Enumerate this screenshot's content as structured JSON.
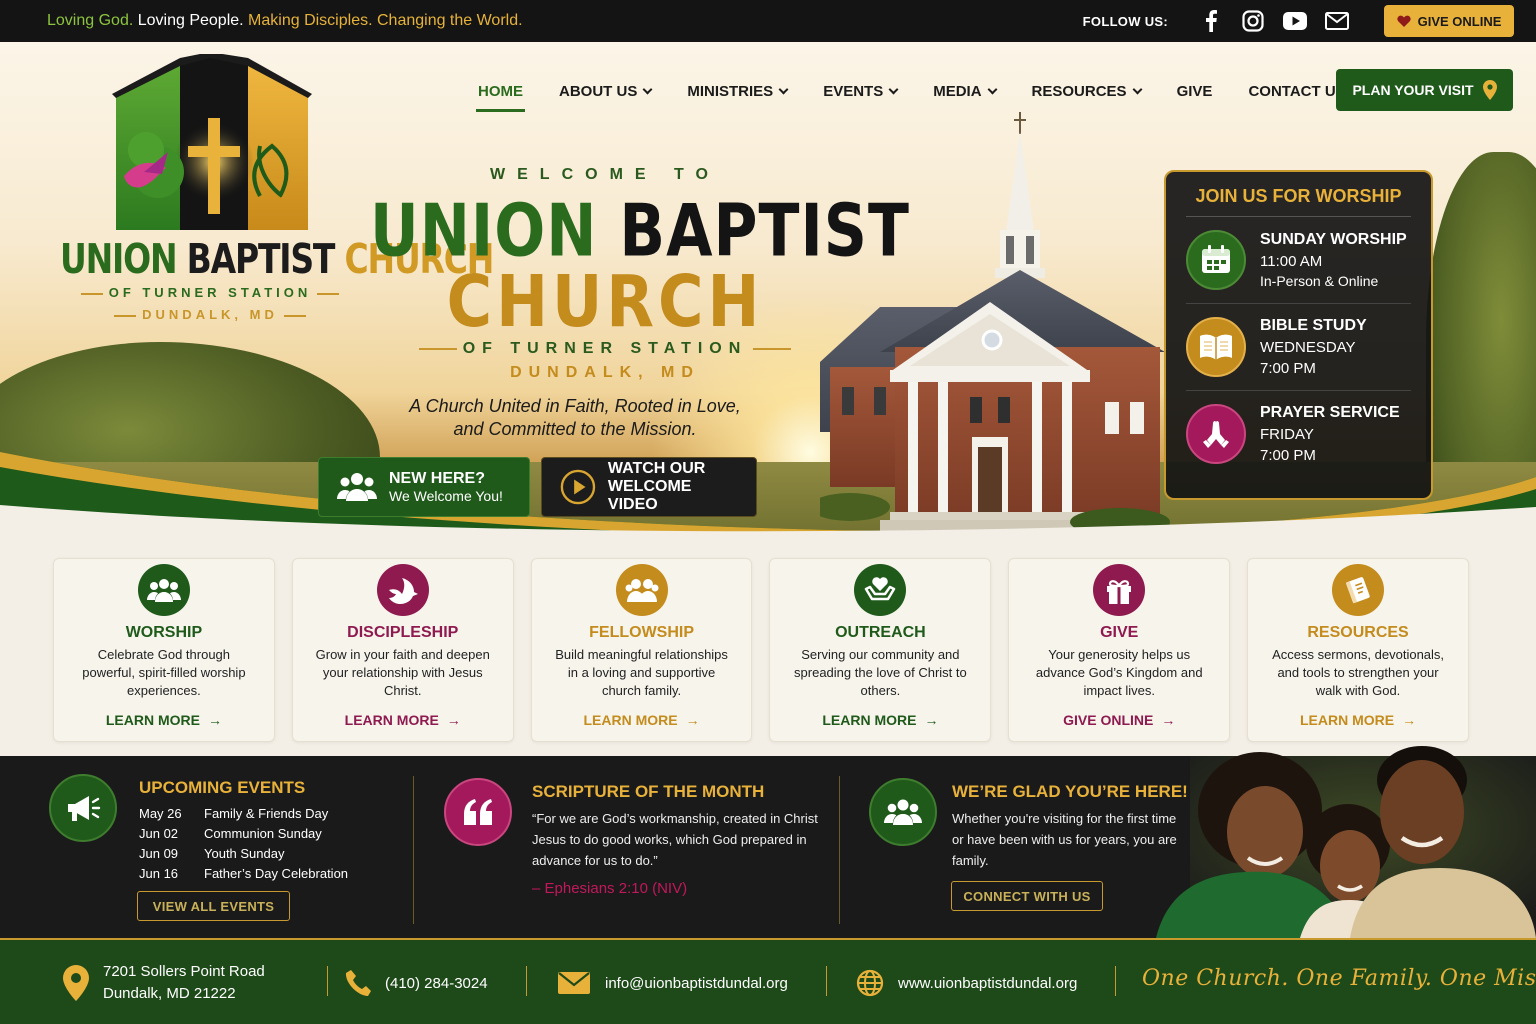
{
  "topbar": {
    "tagline": [
      {
        "text": "Loving God.",
        "color": "green"
      },
      {
        "text": "Loving People.",
        "color": "white"
      },
      {
        "text": "Making Disciples.",
        "color": "gold"
      },
      {
        "text": "Changing the World.",
        "color": "gold"
      }
    ],
    "follow_label": "FOLLOW US:",
    "social_icons": [
      "facebook-icon",
      "instagram-icon",
      "youtube-icon",
      "email-icon"
    ],
    "give_label": "GIVE ONLINE"
  },
  "logo": {
    "title_a": "UNION",
    "title_b": "BAPTIST",
    "title_c": "CHURCH",
    "sub1": "OF TURNER STATION",
    "sub2": "DUNDALK, MD"
  },
  "nav": {
    "items": [
      {
        "label": "HOME",
        "active": true,
        "dropdown": false
      },
      {
        "label": "ABOUT US",
        "dropdown": true
      },
      {
        "label": "MINISTRIES",
        "dropdown": true
      },
      {
        "label": "EVENTS",
        "dropdown": true
      },
      {
        "label": "MEDIA",
        "dropdown": true
      },
      {
        "label": "RESOURCES",
        "dropdown": true
      },
      {
        "label": "GIVE",
        "dropdown": false
      },
      {
        "label": "CONTACT US",
        "dropdown": false
      }
    ],
    "plan_label": "PLAN YOUR VISIT"
  },
  "hero": {
    "welcome": "WELCOME TO",
    "title_a": "UNION",
    "title_b": "BAPTIST",
    "title_c": "CHURCH",
    "sub1": "OF TURNER STATION",
    "sub2": "DUNDALK, MD",
    "mission_line1": "A Church United in Faith, Rooted in Love,",
    "mission_line2": "and Committed to the Mission.",
    "new_here_title": "NEW HERE?",
    "new_here_sub": "We Welcome You!",
    "video_line1": "WATCH OUR",
    "video_line2": "WELCOME VIDEO"
  },
  "worship_panel": {
    "title": "JOIN US FOR WORSHIP",
    "items": [
      {
        "title": "SUNDAY WORSHIP",
        "line2": "11:00 AM",
        "line3": "In-Person & Online",
        "icon": "calendar-icon",
        "color": "#2a6b1e"
      },
      {
        "title": "BIBLE STUDY",
        "line2": "WEDNESDAY",
        "line3": "7:00 PM",
        "icon": "bible-icon",
        "color": "#c48b1d"
      },
      {
        "title": "PRAYER SERVICE",
        "line2": "FRIDAY",
        "line3": "7:00 PM",
        "icon": "praying-hands-icon",
        "color": "#a3195b"
      }
    ]
  },
  "cards": [
    {
      "title": "WORSHIP",
      "text": "Celebrate God through powerful, spirit-filled worship experiences.",
      "link": "LEARN MORE",
      "color": "#1f5a1b",
      "icon": "people-icon"
    },
    {
      "title": "DISCIPLESHIP",
      "text": "Grow in your faith and deepen your relationship with Jesus Christ.",
      "link": "LEARN MORE",
      "color": "#8e1a4f",
      "icon": "dove-icon"
    },
    {
      "title": "FELLOWSHIP",
      "text": "Build meaningful relationships in a loving and supportive church family.",
      "link": "LEARN MORE",
      "color": "#c48b1d",
      "icon": "group-icon"
    },
    {
      "title": "OUTREACH",
      "text": "Serving our community and spreading the love of Christ to others.",
      "link": "LEARN MORE",
      "color": "#1f5a1b",
      "icon": "heart-hands-icon"
    },
    {
      "title": "GIVE",
      "text": "Your generosity helps us advance God’s Kingdom and impact lives.",
      "link": "GIVE ONLINE",
      "color": "#8e1a4f",
      "icon": "gift-icon"
    },
    {
      "title": "RESOURCES",
      "text": "Access sermons, devotionals, and tools to strengthen your walk with God.",
      "link": "LEARN MORE",
      "color": "#c48b1d",
      "icon": "book-icon"
    }
  ],
  "events": {
    "title": "UPCOMING EVENTS",
    "items": [
      {
        "date": "May 26",
        "name": "Family & Friends Day"
      },
      {
        "date": "Jun 02",
        "name": "Communion Sunday"
      },
      {
        "date": "Jun 09",
        "name": "Youth Sunday"
      },
      {
        "date": "Jun 16",
        "name": "Father’s Day Celebration"
      }
    ],
    "button": "VIEW ALL EVENTS"
  },
  "scripture": {
    "title": "SCRIPTURE OF THE MONTH",
    "text": "“For we are God’s workmanship, created in Christ Jesus to do good works, which God prepared in advance for us to do.”",
    "reference": "– Ephesians 2:10 (NIV)"
  },
  "welcome_box": {
    "title": "WE’RE GLAD YOU’RE HERE!",
    "text": "Whether you're visiting for the first time or have been with us for years, you are family.",
    "button": "CONNECT WITH US"
  },
  "footer": {
    "address_line1": "7201 Sollers Point Road",
    "address_line2": "Dundalk, MD 21222",
    "phone": "(410) 284-3024",
    "email": "info@uionbaptistdundal.org",
    "website": "www.uionbaptistdundal.org",
    "slogan": "One Church. One Family. One Mission."
  }
}
